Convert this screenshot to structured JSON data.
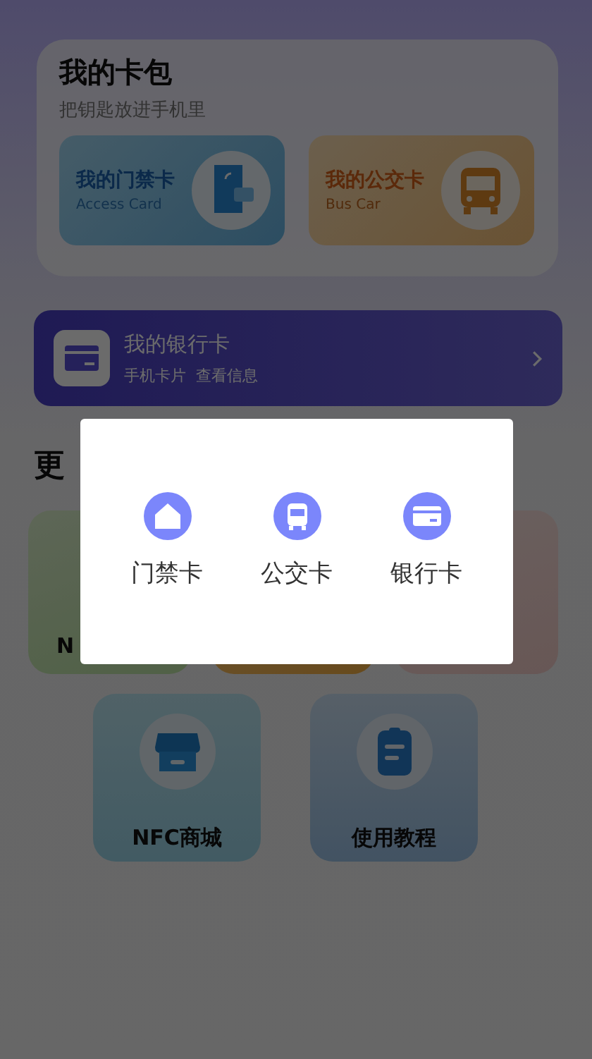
{
  "wallet": {
    "title": "我的卡包",
    "subtitle": "把钥匙放进手机里",
    "cards": [
      {
        "kind": "access",
        "title": "我的门禁卡",
        "subtitle": "Access Card"
      },
      {
        "kind": "bus",
        "title": "我的公交卡",
        "subtitle": "Bus Car"
      }
    ]
  },
  "bank_card": {
    "title": "我的银行卡",
    "subtitle": "手机卡片  查看信息"
  },
  "more": {
    "heading": "更",
    "tiles": [
      {
        "kind": "green",
        "label": "N"
      },
      {
        "kind": "orange"
      },
      {
        "kind": "pink"
      },
      {
        "kind": "store",
        "label": "NFC商城"
      },
      {
        "kind": "guide",
        "label": "使用教程"
      }
    ]
  },
  "dialog": {
    "options": [
      {
        "kind": "access",
        "label": "门禁卡"
      },
      {
        "kind": "bus",
        "label": "公交卡"
      },
      {
        "kind": "bank",
        "label": "银行卡"
      }
    ]
  }
}
